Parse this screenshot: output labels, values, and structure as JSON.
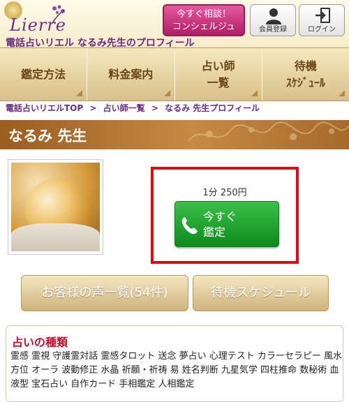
{
  "header": {
    "logo_text": "Lierre",
    "site_title": "電話占いリエル なるみ先生のプロフィール",
    "consult_button": [
      "今すぐ相談！",
      "コンシェルジュ"
    ],
    "register_label": "会員登録",
    "login_label": "ログイン"
  },
  "nav": {
    "items": [
      {
        "label": "鑑定方法"
      },
      {
        "label": "料金案内"
      },
      {
        "label": [
          "占い師",
          "一覧"
        ]
      },
      {
        "label": [
          "待機",
          "ｽｹｼﾞｭｰﾙ"
        ]
      }
    ]
  },
  "breadcrumb": [
    "電話占いリエルTOP",
    "占い師一覧",
    "なるみ 先生プロフィール"
  ],
  "breadcrumb_sep": ">",
  "profile": {
    "name": "なるみ 先生",
    "price": "1分 250円",
    "call_label": [
      "今すぐ",
      "鑑定"
    ]
  },
  "buttons": {
    "reviews": "お客様の声一覧(54件)",
    "schedule": "待機スケジュール"
  },
  "types": {
    "title": "占いの種類",
    "list": "霊感 霊視 守護霊対話 霊感タロット 送念 夢占い 心理テスト カラーセラピー 風水 方位 オーラ 波動修正 水晶 祈願・祈祷 易 姓名判断 九星気学 四柱推命 数秘術 血液型 宝石占い 自作カード 手相鑑定 人相鑑定"
  },
  "colors": {
    "accent_purple": "#6b2a86",
    "highlight_red": "#e60012",
    "call_green": "#1fa12e",
    "consult_pink": "#c8246f"
  }
}
